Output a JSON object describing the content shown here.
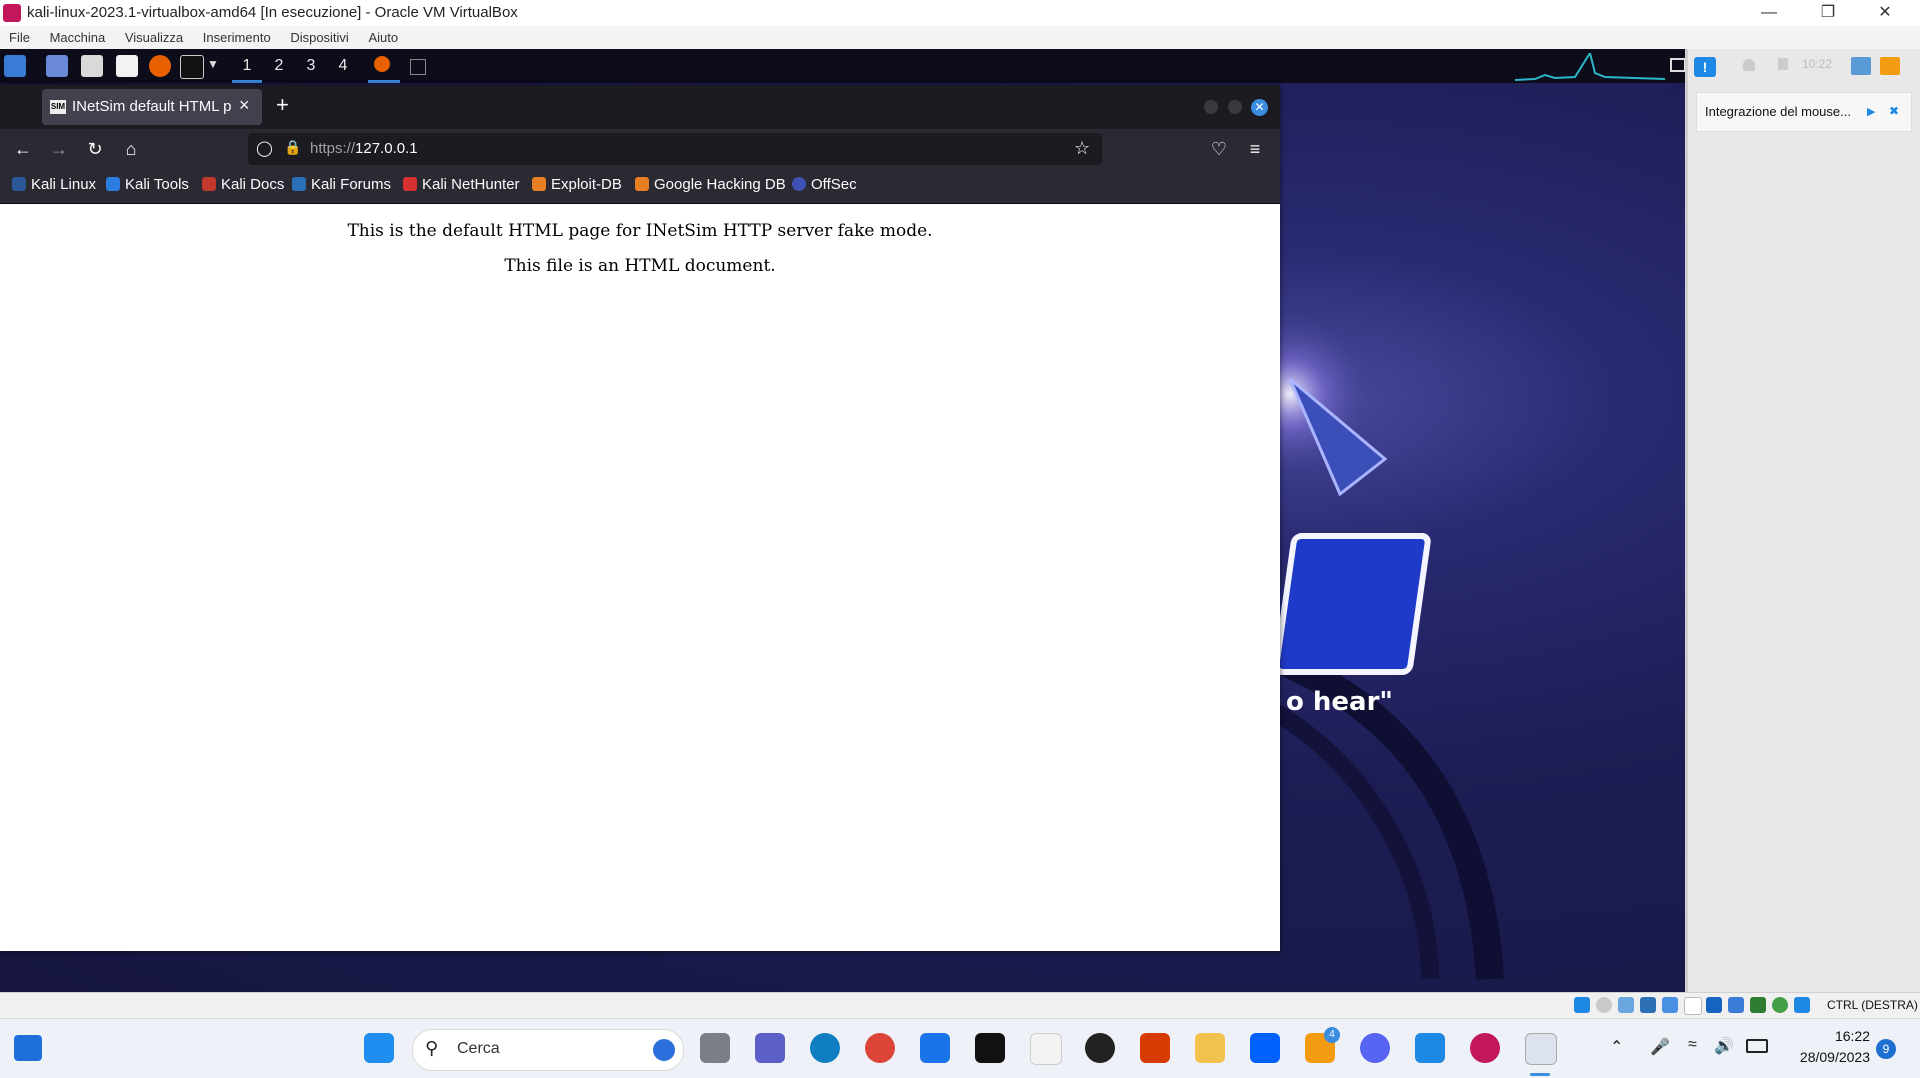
{
  "host": {
    "title": "kali-linux-2023.1-virtualbox-amd64 [In esecuzione] - Oracle VM VirtualBox",
    "menu": [
      "File",
      "Macchina",
      "Visualizza",
      "Inserimento",
      "Dispositivi",
      "Aiuto"
    ],
    "notification": "Integrazione del mouse...",
    "host_key": "CTRL (DESTRA)"
  },
  "guest_panel": {
    "workspaces": [
      "1",
      "2",
      "3",
      "4"
    ],
    "active_workspace": "1",
    "clock": "10:22"
  },
  "browser": {
    "tab_title": "INetSim default HTML page",
    "tab_favicon_text": "SIM",
    "url_scheme": "https://",
    "url_host": "127.0.0.1",
    "bookmarks": [
      "Kali Linux",
      "Kali Tools",
      "Kali Docs",
      "Kali Forums",
      "Kali NetHunter",
      "Exploit-DB",
      "Google Hacking DB",
      "OffSec"
    ],
    "page_lines": [
      "This is the default HTML page for INetSim HTTP server fake mode.",
      "This file is an HTML document."
    ]
  },
  "wallpaper_text": "o  hear\"",
  "taskbar": {
    "search_placeholder": "Cerca",
    "time": "16:22",
    "date": "28/09/2023",
    "notification_count": "9",
    "badge_count": "4"
  },
  "colors": {
    "accent": "#3b8de0",
    "firefox_dark": "#1c1b22",
    "firefox_toolbar": "#2b2a33",
    "wallpaper": "#1d1d55"
  }
}
